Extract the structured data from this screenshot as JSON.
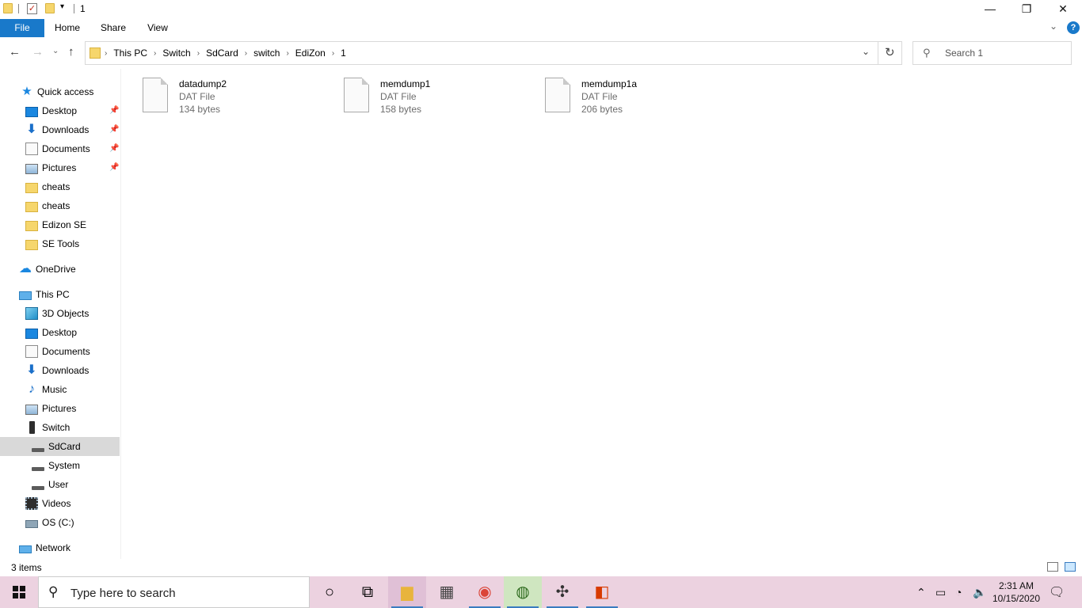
{
  "window": {
    "title": "1",
    "controls": {
      "minimize": "—",
      "restore": "❐",
      "close": "✕"
    }
  },
  "ribbon": {
    "tabs": [
      "File",
      "Home",
      "Share",
      "View"
    ],
    "help": "?"
  },
  "address": {
    "crumbs": [
      "This PC",
      "Switch",
      "SdCard",
      "switch",
      "EdiZon",
      "1"
    ],
    "search_placeholder": "Search 1"
  },
  "navigation": {
    "quick_access": "Quick access",
    "quick_items": [
      {
        "label": "Desktop",
        "icon": "desktop-icon",
        "pinned": true
      },
      {
        "label": "Downloads",
        "icon": "download-icon",
        "pinned": true
      },
      {
        "label": "Documents",
        "icon": "documents-icon",
        "pinned": true
      },
      {
        "label": "Pictures",
        "icon": "pictures-icon",
        "pinned": true
      },
      {
        "label": "cheats",
        "icon": "folder-icon",
        "pinned": false
      },
      {
        "label": "cheats",
        "icon": "folder-icon",
        "pinned": false
      },
      {
        "label": "Edizon SE",
        "icon": "folder-icon",
        "pinned": false
      },
      {
        "label": "SE Tools",
        "icon": "folder-icon",
        "pinned": false
      }
    ],
    "onedrive": "OneDrive",
    "this_pc": "This PC",
    "pc_items": [
      {
        "label": "3D Objects",
        "icon": "3d-objects-icon"
      },
      {
        "label": "Desktop",
        "icon": "desktop-icon"
      },
      {
        "label": "Documents",
        "icon": "documents-icon"
      },
      {
        "label": "Downloads",
        "icon": "download-icon"
      },
      {
        "label": "Music",
        "icon": "music-icon"
      },
      {
        "label": "Pictures",
        "icon": "pictures-icon"
      },
      {
        "label": "Switch",
        "icon": "switch-device-icon"
      },
      {
        "label": "SdCard",
        "icon": "drive-icon",
        "selected": true
      },
      {
        "label": "System",
        "icon": "drive-icon"
      },
      {
        "label": "User",
        "icon": "drive-icon"
      },
      {
        "label": "Videos",
        "icon": "videos-icon"
      },
      {
        "label": "OS (C:)",
        "icon": "os-drive-icon"
      }
    ],
    "network": "Network"
  },
  "files": [
    {
      "name": "datadump2",
      "type": "DAT File",
      "size": "134 bytes"
    },
    {
      "name": "memdump1",
      "type": "DAT File",
      "size": "158 bytes"
    },
    {
      "name": "memdump1a",
      "type": "DAT File",
      "size": "206 bytes"
    }
  ],
  "status": {
    "count": "3 items"
  },
  "taskbar": {
    "search_placeholder": "Type here to search",
    "time": "2:31 AM",
    "date": "10/15/2020"
  },
  "colors": {
    "accent": "#1979ca",
    "taskbar": "#ecd2e0",
    "selected_nav": "#d9d9d9"
  }
}
